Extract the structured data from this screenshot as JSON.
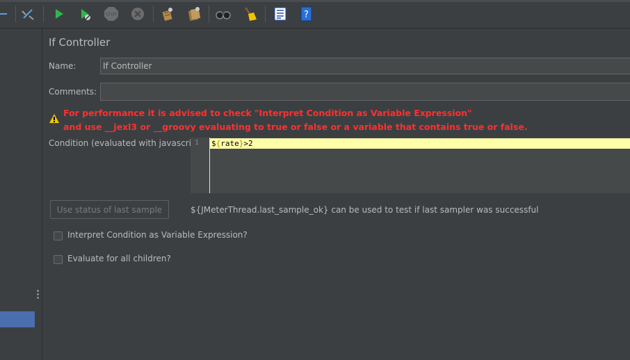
{
  "toolbar": {
    "icons": [
      {
        "name": "collapse-icon",
        "state": "enabled"
      },
      {
        "name": "toggle-icon",
        "state": "enabled"
      },
      {
        "name": "start-icon",
        "state": "enabled"
      },
      {
        "name": "start-no-pauses-icon",
        "state": "enabled"
      },
      {
        "name": "stop-icon",
        "state": "disabled"
      },
      {
        "name": "shutdown-icon",
        "state": "disabled"
      },
      {
        "name": "clear-icon",
        "state": "enabled"
      },
      {
        "name": "clear-all-icon",
        "state": "enabled"
      },
      {
        "name": "search-icon",
        "state": "enabled"
      },
      {
        "name": "reset-search-icon",
        "state": "enabled"
      },
      {
        "name": "function-helper-icon",
        "state": "enabled"
      },
      {
        "name": "help-icon",
        "state": "enabled"
      }
    ],
    "stop_label": "STOP",
    "help_label": "?"
  },
  "panel": {
    "title": "If Controller",
    "name_label": "Name:",
    "name_value": "If Controller",
    "comments_label": "Comments:",
    "comments_value": "",
    "warning_line1": "For performance it is advised to check \"Interpret Condition as Variable Expression\"",
    "warning_line2": "and use __jexl3 or __groovy evaluating to true or false or a variable that contains true or false.",
    "condition_label": "Condition (evaluated with javascript)",
    "editor": {
      "line_number": "1",
      "code_prefix": "$",
      "code_open": "{",
      "code_var": "rate",
      "code_close": "}",
      "code_suffix": ">2"
    },
    "use_status_button": "Use status of last sample",
    "hint": "${JMeterThread.last_sample_ok} can be used to test if last sampler was successful",
    "checkbox_interpret": {
      "label": "Interpret Condition as Variable Expression?",
      "checked": false
    },
    "checkbox_evaluate": {
      "label": "Evaluate for all children?",
      "checked": false
    }
  },
  "colors": {
    "background": "#3c3f41",
    "field": "#45494a",
    "warning": "#ff3030",
    "selection": "#4b6eaf",
    "editor_line": "#ffffaa"
  }
}
